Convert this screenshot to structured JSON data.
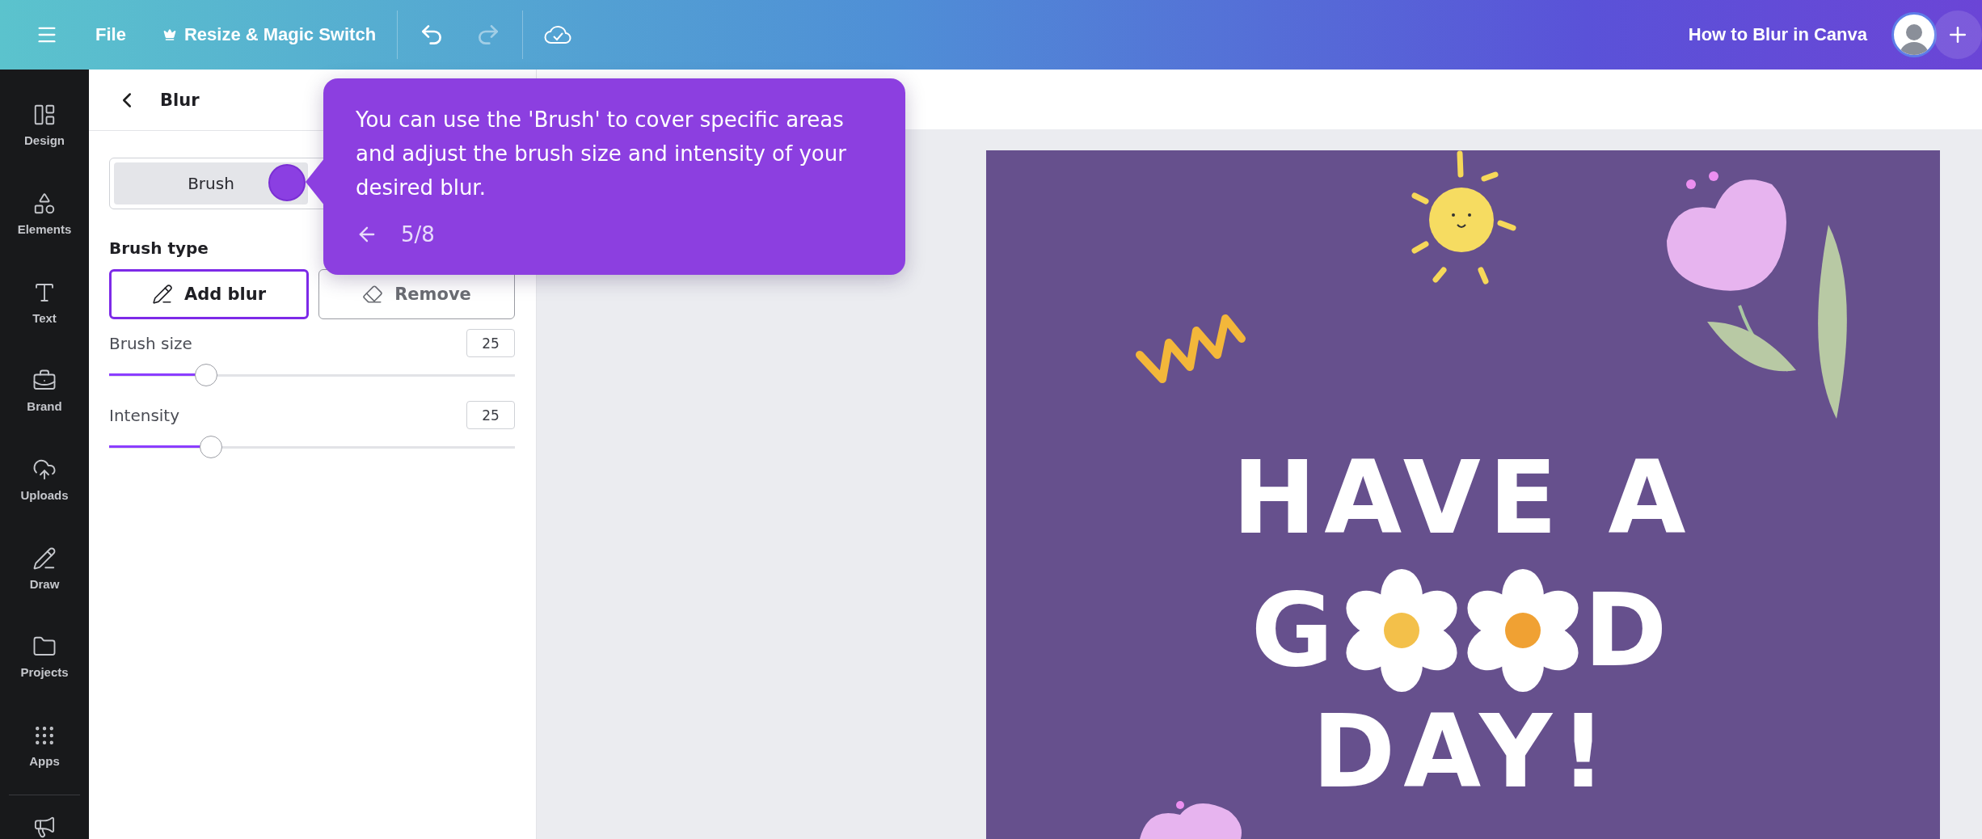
{
  "topbar": {
    "file": "File",
    "resize": "Resize & Magic Switch",
    "title": "How to Blur in Canva"
  },
  "sidebar": {
    "items": [
      {
        "label": "Design",
        "kind": "design"
      },
      {
        "label": "Elements",
        "kind": "elements"
      },
      {
        "label": "Text",
        "kind": "text"
      },
      {
        "label": "Brand",
        "kind": "brand"
      },
      {
        "label": "Uploads",
        "kind": "uploads"
      },
      {
        "label": "Draw",
        "kind": "draw"
      },
      {
        "label": "Projects",
        "kind": "projects"
      },
      {
        "label": "Apps",
        "kind": "apps"
      }
    ]
  },
  "panel": {
    "title": "Blur",
    "mode_tabs": [
      {
        "label": "Brush",
        "selected": true
      }
    ],
    "brush_type_label": "Brush type",
    "brush_types": [
      {
        "label": "Add blur",
        "kind": "add",
        "selected": true
      },
      {
        "label": "Remove",
        "kind": "remove",
        "selected": false
      }
    ],
    "sliders": [
      {
        "label": "Brush size",
        "value": "25",
        "level": 0.24
      },
      {
        "label": "Intensity",
        "value": "25",
        "level": 0.25
      }
    ]
  },
  "tooltip": {
    "text": "You can use the 'Brush' to cover specific areas and adjust the brush size and intensity of your desired blur.",
    "step": "5/8"
  },
  "design": {
    "line_1": "HAVE A",
    "line_2_start": "G",
    "line_2_end": "D",
    "line_3": "DAY!"
  }
}
